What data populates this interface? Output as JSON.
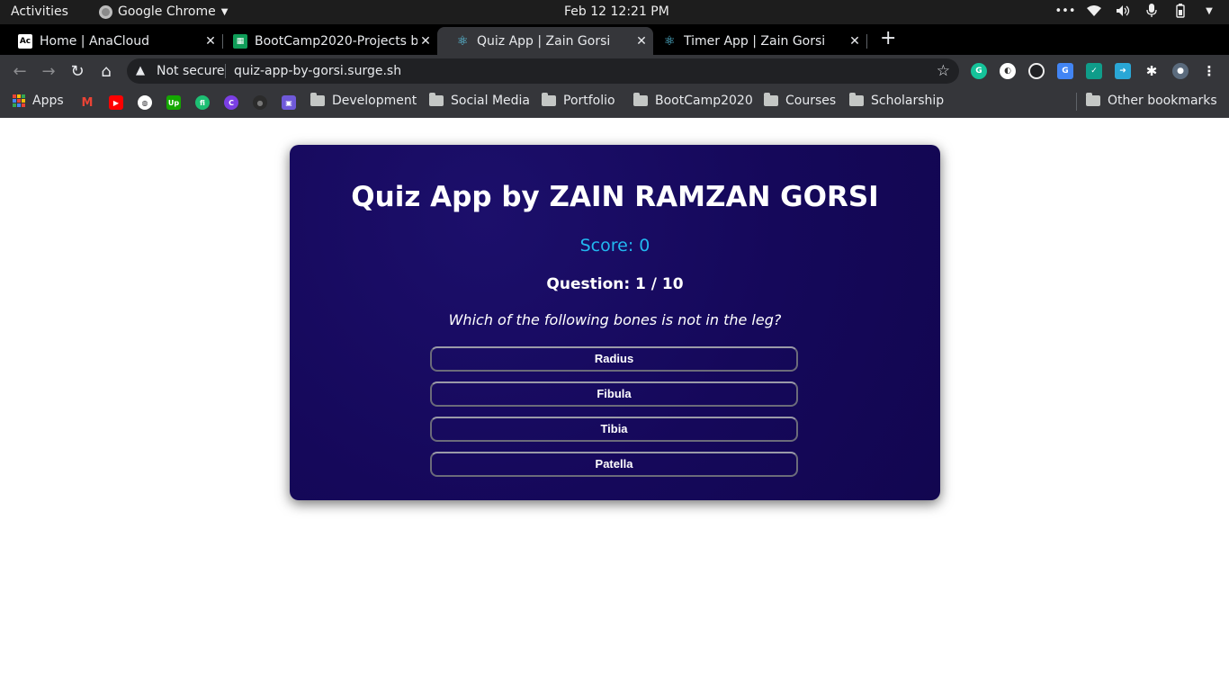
{
  "system_bar": {
    "activities": "Activities",
    "app_name": "Google Chrome",
    "clock": "Feb 12  12:21 PM"
  },
  "tabs": [
    {
      "title": "Home | AnaCloud",
      "favicon": "anacloud-icon",
      "active": false
    },
    {
      "title": "BootCamp2020-Projects b",
      "favicon": "sheets-icon",
      "active": false
    },
    {
      "title": "Quiz App | Zain Gorsi",
      "favicon": "react-icon",
      "active": true
    },
    {
      "title": "Timer App | Zain Gorsi",
      "favicon": "react-icon",
      "active": false
    }
  ],
  "omnibox": {
    "security": "Not secure",
    "url": "quiz-app-by-gorsi.surge.sh"
  },
  "bookmarks": {
    "apps": "Apps",
    "folders": [
      "Development",
      "Social Media",
      "Portfolio",
      "BootCamp2020",
      "Courses",
      "Scholarship"
    ],
    "other": "Other bookmarks"
  },
  "quiz": {
    "title": "Quiz App by ZAIN RAMZAN GORSI",
    "score": "Score: 0",
    "question_number": "Question: 1 / 10",
    "question": "Which of the following bones is not in the leg?",
    "options": [
      "Radius",
      "Fibula",
      "Tibia",
      "Patella"
    ]
  },
  "colors": {
    "card_bg": "#15085a",
    "score_text": "#22b8f0",
    "chrome_dark": "#35363a"
  }
}
